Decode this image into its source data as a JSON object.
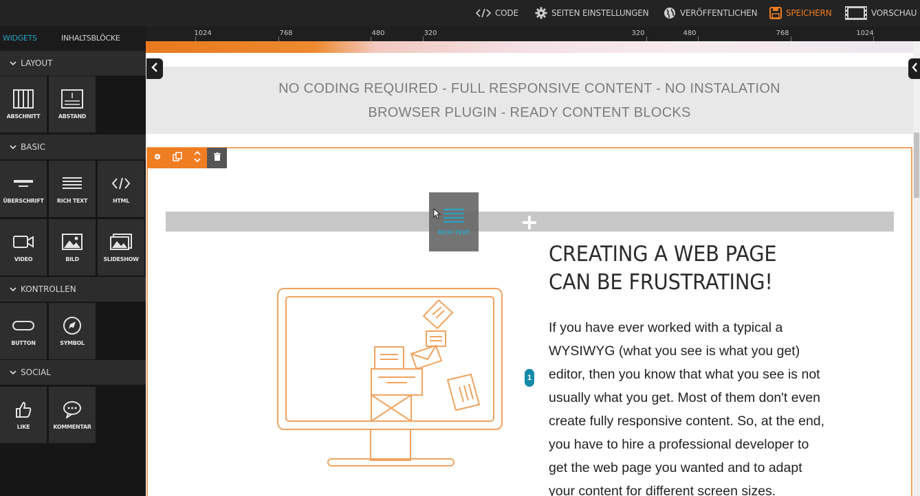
{
  "topbar": {
    "code": "CODE",
    "settings": "SEITEN EINSTELLUNGEN",
    "publish": "VERÖFFENTLICHEN",
    "save": "SPEICHERN",
    "preview": "VORSCHAU"
  },
  "sidebar": {
    "tabs": [
      "WIDGETS",
      "INHALTSBLÖCKE"
    ],
    "sections": {
      "layout": {
        "title": "LAYOUT",
        "items": [
          "ABSCHNITT",
          "ABSTAND"
        ]
      },
      "basic": {
        "title": "BASIC",
        "items": [
          "ÜBERSCHRIFT",
          "RICH TEXT",
          "HTML",
          "VIDEO",
          "BILD",
          "SLIDESHOW"
        ]
      },
      "controls": {
        "title": "KONTROLLEN",
        "items": [
          "BUTTON",
          "SYMBOL"
        ]
      },
      "social": {
        "title": "SOCIAL",
        "items": [
          "LIKE",
          "KOMMENTAR"
        ]
      }
    }
  },
  "ruler": {
    "labels": [
      "1024",
      "768",
      "480",
      "320",
      "320",
      "480",
      "768",
      "1024"
    ]
  },
  "canvas": {
    "banner_line1": "NO CODING REQUIRED - FULL RESPONSIVE CONTENT - NO INSTALATION",
    "banner_line2": "BROWSER PLUGIN - READY CONTENT BLOCKS",
    "drag_label": "RICH TEXT",
    "heading_line1": "CREATING A WEB PAGE",
    "heading_line2": "CAN BE FRUSTRATING!",
    "paragraph_lines": [
      "If you have ever worked with a typical a",
      "WYSIWYG (what you see is what you get)",
      "editor, then you know that what you see is not",
      "usually what you get. Most of them don't even",
      "create fully responsive content. So, at the end,",
      "you have to hire a professional developer to",
      "get the web page you wanted and to adapt",
      "your content for different screen sizes."
    ],
    "badge": "1"
  },
  "colors": {
    "accent": "#ef7d22",
    "teal": "#148aa8",
    "sidebar_bg": "#161616",
    "tile_bg": "#2e2e2e"
  }
}
